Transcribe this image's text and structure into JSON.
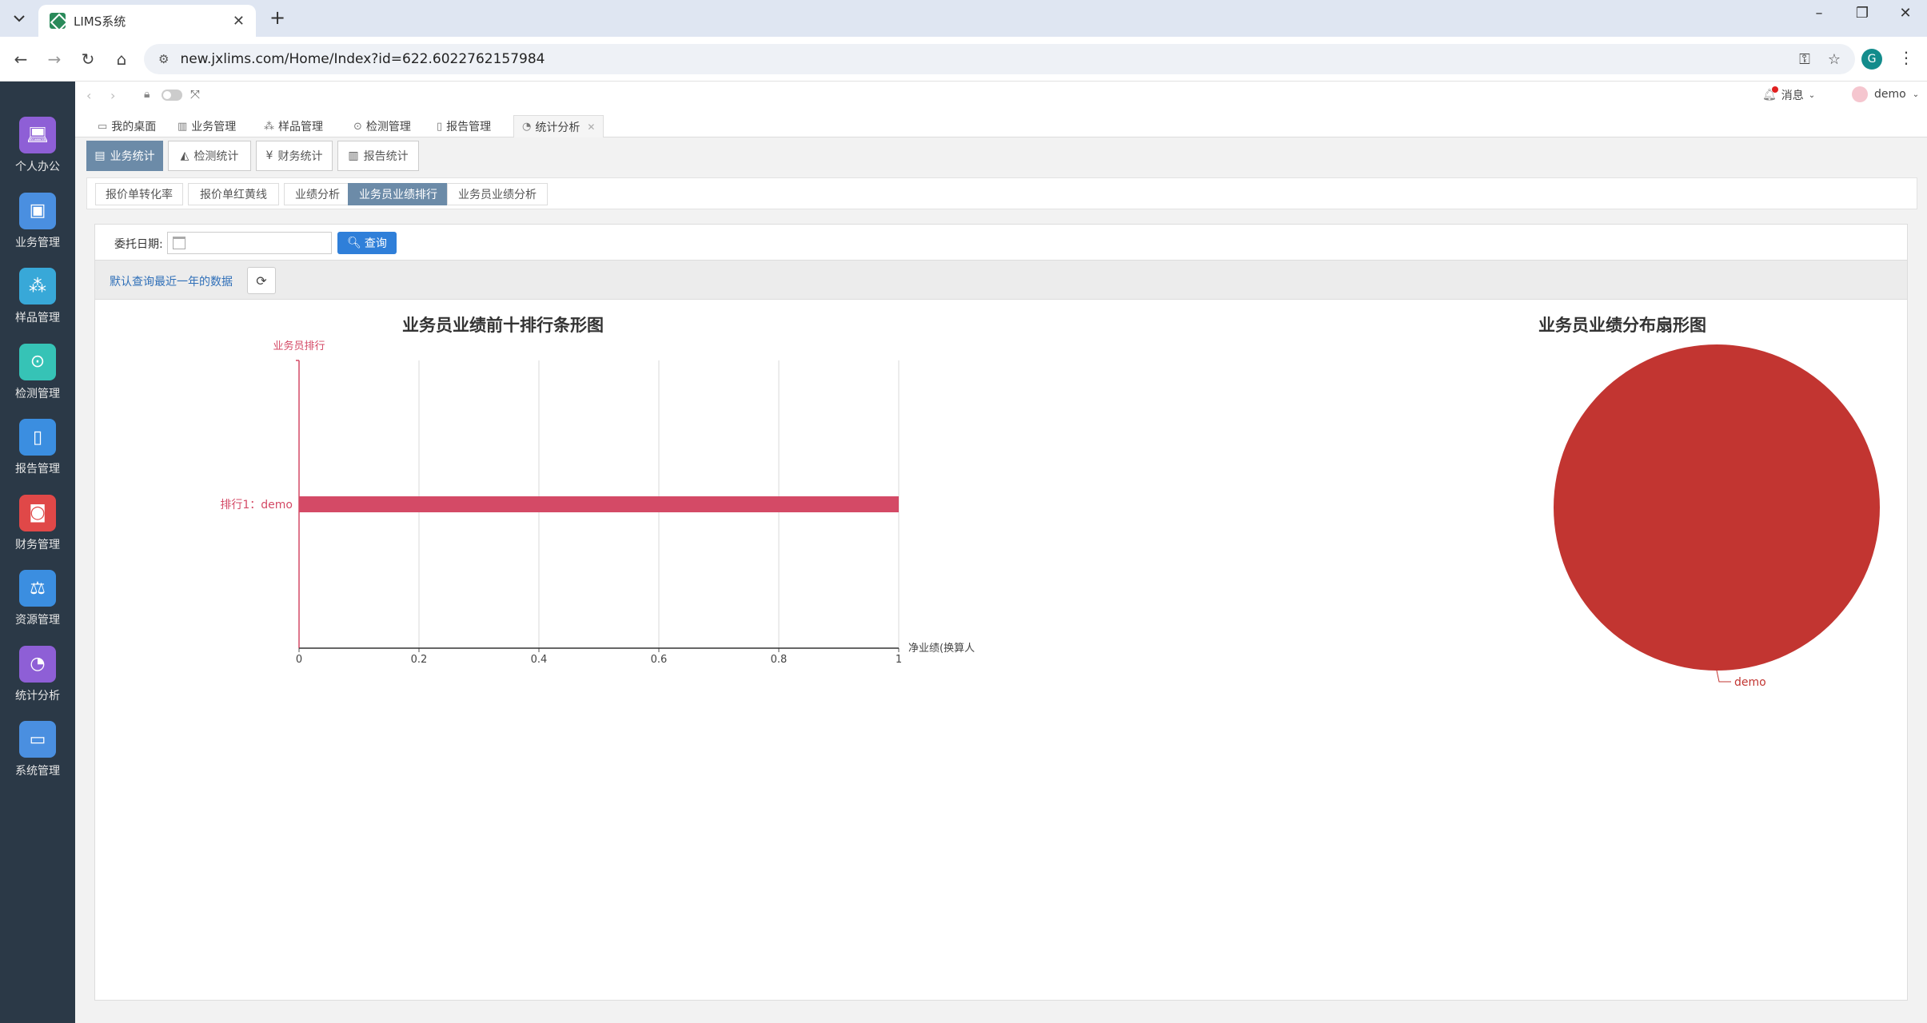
{
  "browser": {
    "tab_title": "LIMS系统",
    "url": "new.jxlims.com/Home/Index?id=622.6022762157984",
    "profile_initial": "G"
  },
  "sidebar": {
    "items": [
      {
        "label": "个人办公",
        "icon": "laptop-icon",
        "color": "#8e5fd6"
      },
      {
        "label": "业务管理",
        "icon": "briefcase-icon",
        "color": "#4a8fe0"
      },
      {
        "label": "样品管理",
        "icon": "cubes-icon",
        "color": "#38a8d8"
      },
      {
        "label": "检测管理",
        "icon": "map-pin-icon",
        "color": "#36c3b6"
      },
      {
        "label": "报告管理",
        "icon": "report-file-icon",
        "color": "#3b8ee0"
      },
      {
        "label": "财务管理",
        "icon": "money-icon",
        "color": "#e04848"
      },
      {
        "label": "资源管理",
        "icon": "scale-icon",
        "color": "#3b8ee0"
      },
      {
        "label": "统计分析",
        "icon": "pie-chart-icon",
        "color": "#8e5fd6"
      },
      {
        "label": "系统管理",
        "icon": "monitor-icon",
        "color": "#4a8fe0"
      }
    ]
  },
  "header": {
    "messages_label": "消息",
    "user_label": "demo"
  },
  "main_tabs": [
    {
      "label": "我的桌面",
      "icon": "desktop-icon"
    },
    {
      "label": "业务管理",
      "icon": "bar-icon"
    },
    {
      "label": "样品管理",
      "icon": "cubes-icon"
    },
    {
      "label": "检测管理",
      "icon": "pin-icon"
    },
    {
      "label": "报告管理",
      "icon": "file-icon"
    },
    {
      "label": "统计分析",
      "icon": "pie-icon"
    }
  ],
  "stat_tabs": [
    {
      "label": "业务统计"
    },
    {
      "label": "检测统计"
    },
    {
      "label": "财务统计"
    },
    {
      "label": "报告统计"
    }
  ],
  "sub_tabs": [
    {
      "label": "报价单转化率"
    },
    {
      "label": "报价单红黄线"
    },
    {
      "label": "业绩分析"
    },
    {
      "label": "业务员业绩排行"
    },
    {
      "label": "业务员业绩分析"
    }
  ],
  "filter": {
    "date_label": "委托日期:",
    "date_value": "",
    "query_label": "查询",
    "hint": "默认查询最近一年的数据"
  },
  "chart_data": [
    {
      "type": "bar",
      "orientation": "horizontal",
      "title": "业务员业绩前十排行条形图",
      "ylabel": "业务员排行",
      "xlabel": "净业绩(换算人民币)",
      "categories": [
        "排行1：demo"
      ],
      "values": [
        1
      ],
      "xlim": [
        0,
        1
      ],
      "xticks": [
        "0",
        "0.2",
        "0.4",
        "0.6",
        "0.8",
        "1"
      ],
      "grid": true,
      "color": "#d44a66"
    },
    {
      "type": "pie",
      "title": "业务员业绩分布扇形图",
      "labels": [
        "demo"
      ],
      "values": [
        1
      ],
      "color": "#c23531"
    }
  ]
}
